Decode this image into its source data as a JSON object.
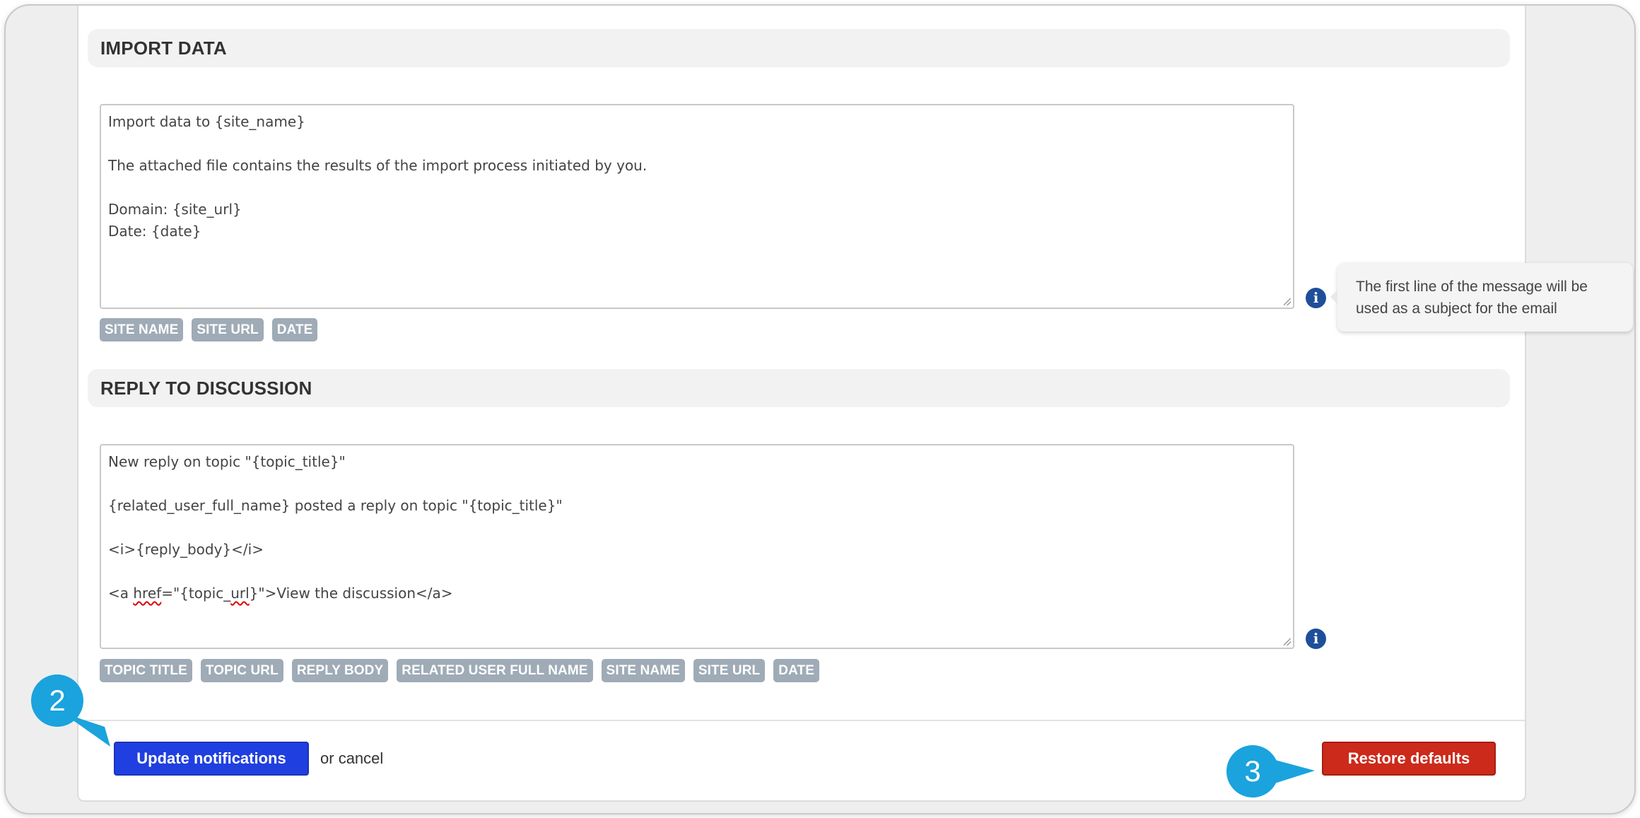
{
  "sections": {
    "import": {
      "title": "IMPORT DATA",
      "body_lines": [
        "Import data to {site_name}",
        "",
        "The attached file contains the results of the import process initiated by you.",
        "",
        "Domain: {site_url}",
        "Date: {date}"
      ],
      "tags": [
        "SITE NAME",
        "SITE URL",
        "DATE"
      ]
    },
    "reply": {
      "title": "REPLY TO DISCUSSION",
      "line1": "New reply on topic \"{topic_title}\"",
      "line2": "{related_user_full_name} posted a reply on topic \"{topic_title}\"",
      "line3": "<i>{reply_body}</i>",
      "line4_pre": "<a ",
      "line4_href": "href",
      "line4_mid": "=\"{topic_",
      "line4_url": "url",
      "line4_post": "}\">View the discussion</a>",
      "tags": [
        "TOPIC TITLE",
        "TOPIC URL",
        "REPLY BODY",
        "RELATED USER FULL NAME",
        "SITE NAME",
        "SITE URL",
        "DATE"
      ]
    }
  },
  "tooltip": {
    "text": "The first line of the message will be used as a subject for the email"
  },
  "info_icon_glyph": "i",
  "actions": {
    "update_label": "Update notifications",
    "or_text": "or",
    "cancel_label": "cancel",
    "restore_label": "Restore defaults"
  },
  "callouts": {
    "step2": "2",
    "step3": "3"
  },
  "colors": {
    "update_button": "#1f3fe0",
    "restore_button": "#cc2a1b",
    "callout": "#1aa3dd",
    "tag": "#9fabb6",
    "info_icon": "#1f4e9a"
  }
}
